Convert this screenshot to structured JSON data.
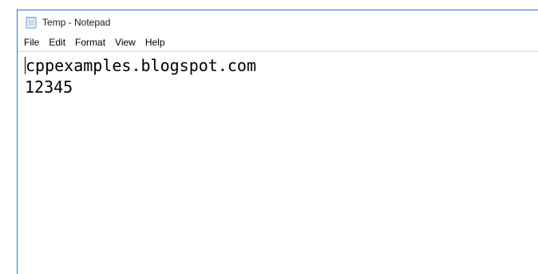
{
  "window": {
    "title": "Temp - Notepad",
    "icon": "notepad-icon"
  },
  "menu": {
    "items": [
      "File",
      "Edit",
      "Format",
      "View",
      "Help"
    ]
  },
  "editor": {
    "lines": [
      "cppexamples.blogspot.com",
      "12345"
    ]
  },
  "colors": {
    "window_border": "#2b7bd6"
  }
}
